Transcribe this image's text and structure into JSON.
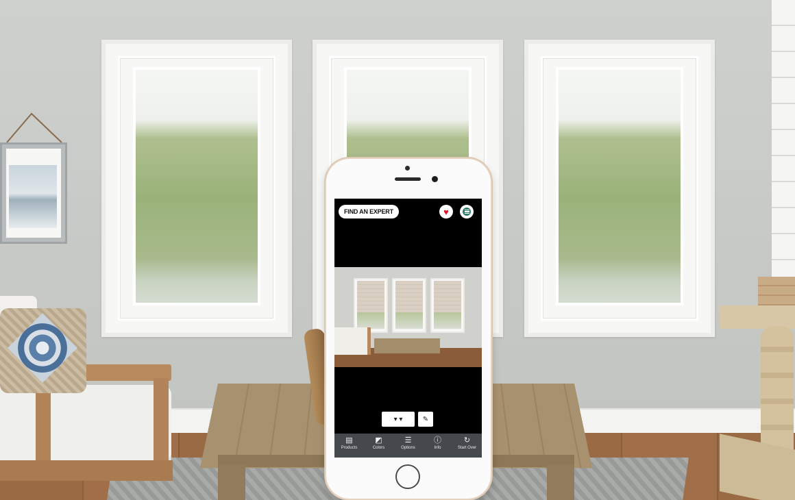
{
  "app": {
    "expert_button_label": "FIND AN EXPERT",
    "favorites_icon_glyph": "♥",
    "accent_color": "#d6182a",
    "menu_color": "#2e7d6c"
  },
  "toolbar": {
    "shade_tool_glyph": "▾ ▾",
    "wand_tool_glyph": "✎"
  },
  "tabs": [
    {
      "label": "Products",
      "icon": "products-icon",
      "glyph": "▤"
    },
    {
      "label": "Colors",
      "icon": "palette-icon",
      "glyph": "◩"
    },
    {
      "label": "Options",
      "icon": "sliders-icon",
      "glyph": "☰"
    },
    {
      "label": "Info",
      "icon": "info-icon",
      "glyph": "ⓘ"
    },
    {
      "label": "Start Over",
      "icon": "refresh-icon",
      "glyph": "↻"
    }
  ]
}
